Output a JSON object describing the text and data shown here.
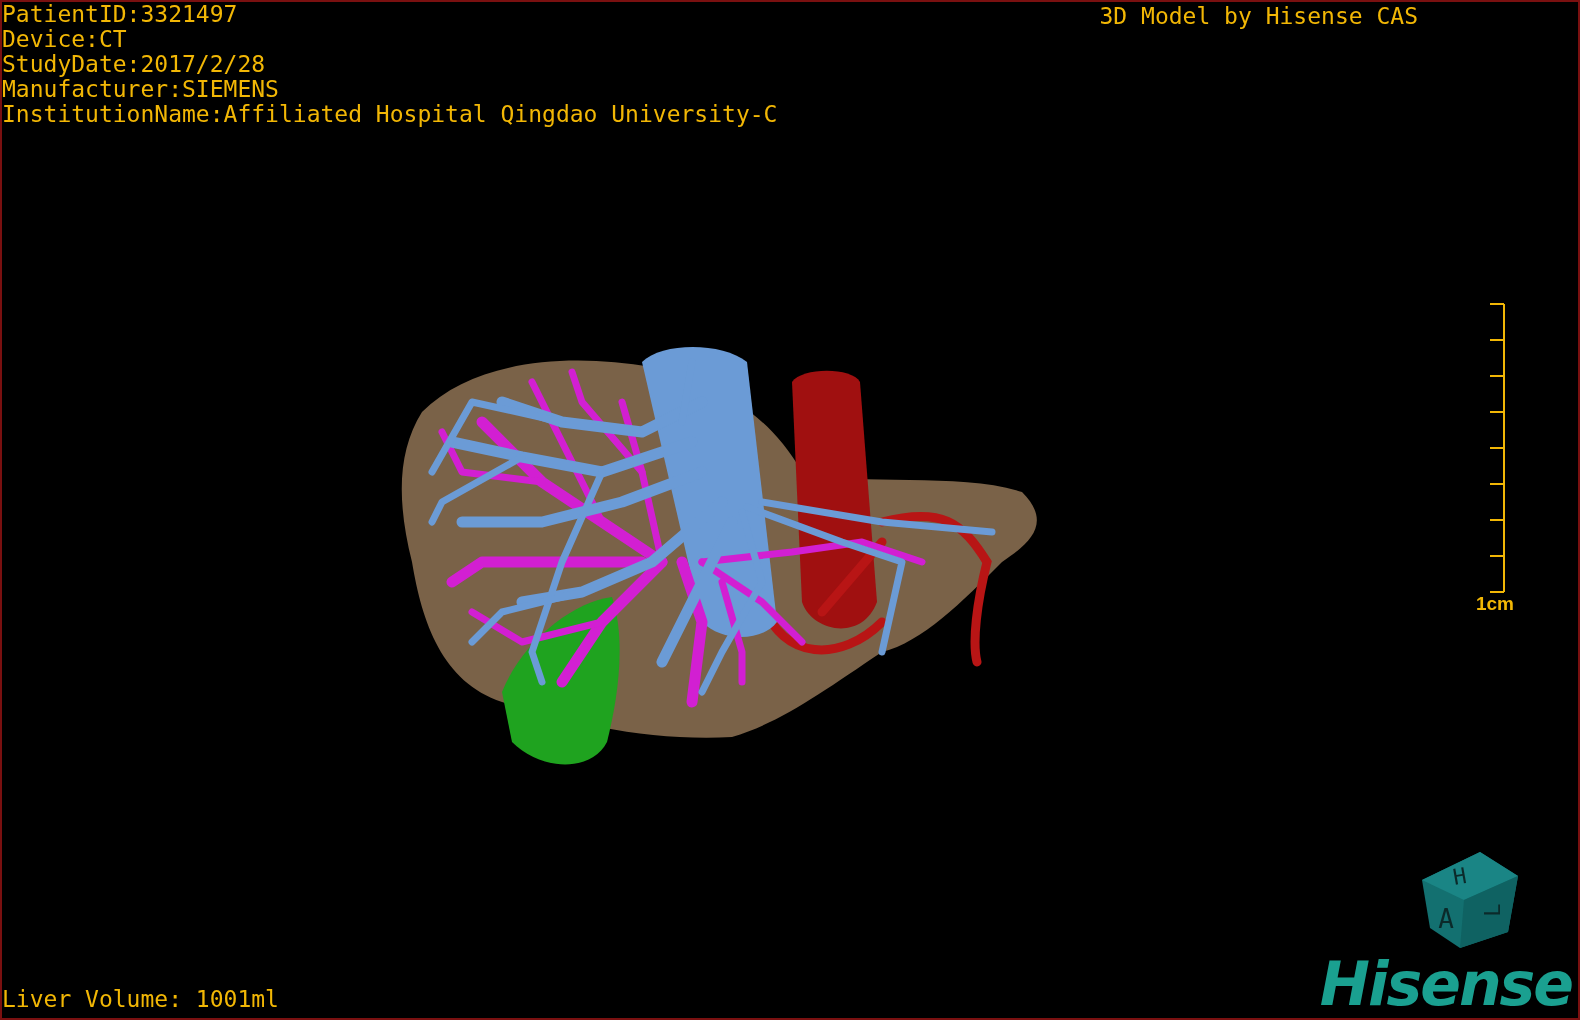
{
  "info_lines": [
    "PatientID:3321497",
    "Device:CT",
    "StudyDate:2017/2/28",
    "Manufacturer:SIEMENS",
    "InstitutionName:Affiliated Hospital Qingdao University-C"
  ],
  "title": "3D Model by Hisense CAS",
  "scale_bar": {
    "label": "1cm"
  },
  "orientation_cube": {
    "labels": [
      "H",
      "A",
      "L"
    ]
  },
  "liver_volume": "Liver Volume: 1001ml",
  "logo": "Hisense"
}
